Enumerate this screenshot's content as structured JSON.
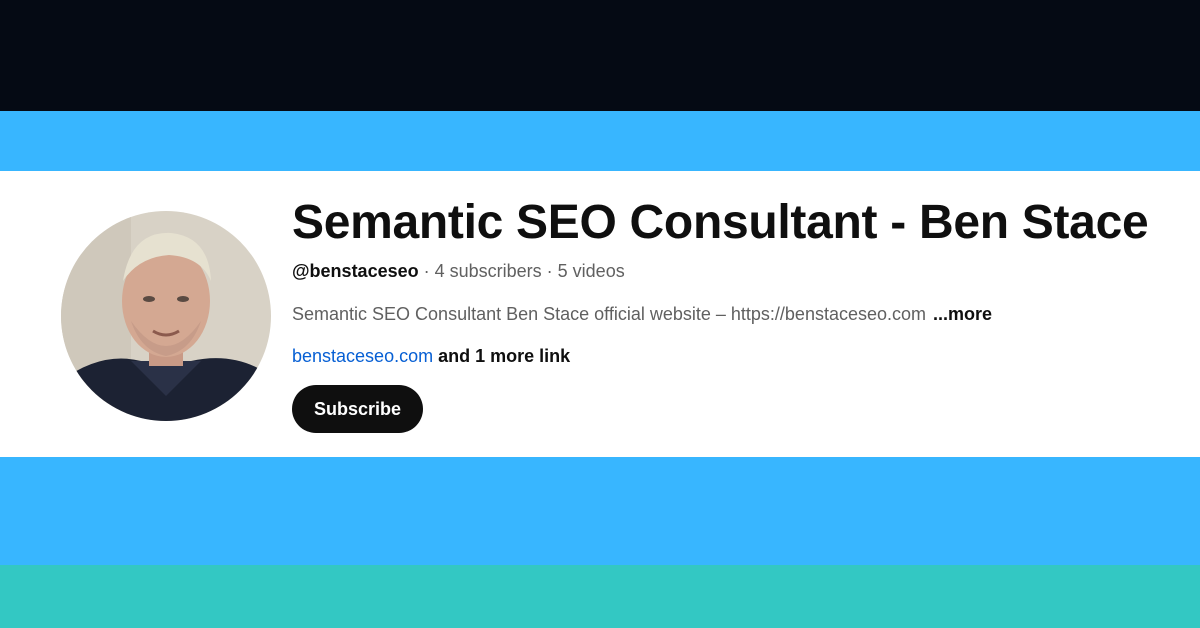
{
  "colors": {
    "top_band": "#050a14",
    "blue_band": "#38b6ff",
    "teal_band": "#33c8c3",
    "card_bg": "#ffffff",
    "text_primary": "#0f0f0f",
    "text_secondary": "#606060",
    "link": "#065fd4",
    "button_bg": "#0f0f0f",
    "button_text": "#ffffff"
  },
  "channel": {
    "avatar_icon": "profile-photo",
    "title": "Semantic SEO Consultant - Ben Stace",
    "handle": "@benstaceseo",
    "separator": "·",
    "subscribers": "4 subscribers",
    "videos": "5 videos",
    "description": "Semantic SEO Consultant Ben Stace official website – https://benstaceseo.com",
    "more_label": "...more",
    "link_text": "benstaceseo.com",
    "more_links": "and 1 more link",
    "subscribe_label": "Subscribe"
  }
}
